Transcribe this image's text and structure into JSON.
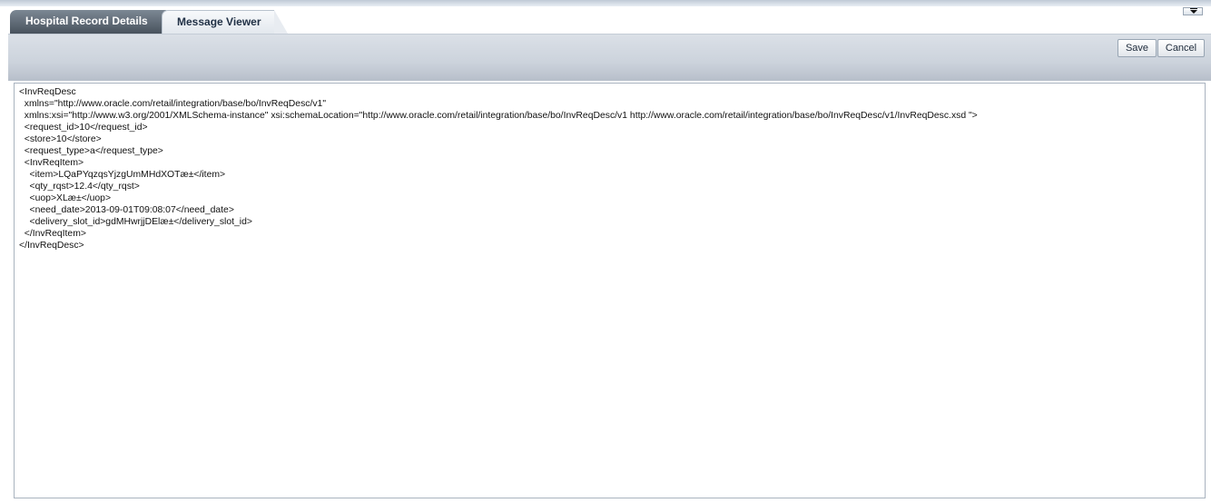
{
  "tabs": [
    {
      "label": "Hospital Record Details",
      "active": false
    },
    {
      "label": "Message Viewer",
      "active": true
    }
  ],
  "toolbar": {
    "save_label": "Save",
    "cancel_label": "Cancel"
  },
  "viewer": {
    "lines": [
      "<InvReqDesc",
      "  xmlns=\"http://www.oracle.com/retail/integration/base/bo/InvReqDesc/v1\"",
      "  xmlns:xsi=\"http://www.w3.org/2001/XMLSchema-instance\" xsi:schemaLocation=\"http://www.oracle.com/retail/integration/base/bo/InvReqDesc/v1 http://www.oracle.com/retail/integration/base/bo/InvReqDesc/v1/InvReqDesc.xsd \">",
      "  <request_id>10</request_id>",
      "  <store>10</store>",
      "  <request_type>a</request_type>",
      "  <InvReqItem>",
      "    <item>LQaPYqzqsYjzgUmMHdXOTæ±</item>",
      "    <qty_rqst>12.4</qty_rqst>",
      "    <uop>XLæ±</uop>",
      "    <need_date>2013-09-01T09:08:07</need_date>",
      "    <delivery_slot_id>gdMHwrjjDElæ±</delivery_slot_id>",
      "  </InvReqItem>",
      "</InvReqDesc>"
    ]
  }
}
